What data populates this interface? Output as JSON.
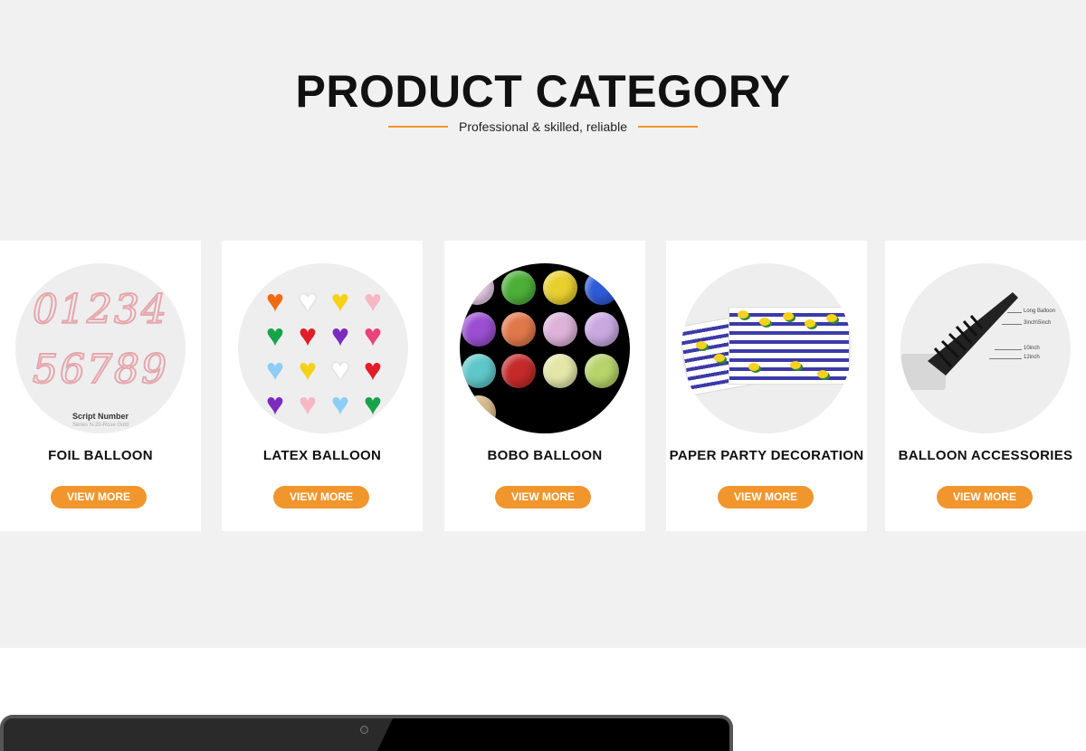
{
  "header": {
    "title": "PRODUCT CATEGORY",
    "subtitle": "Professional & skilled, reliable"
  },
  "categories": [
    {
      "name": "FOIL BALLOON",
      "button": "VIEW MORE",
      "image_caption": "Script Number",
      "image_subcaption": "Series N-20-Rose Gold",
      "digits_row1": "01234",
      "digits_row2": "56789"
    },
    {
      "name": "LATEX BALLOON",
      "button": "VIEW MORE"
    },
    {
      "name": "BOBO BALLOON",
      "button": "VIEW MORE"
    },
    {
      "name": "PAPER PARTY DECORATION",
      "button": "VIEW MORE"
    },
    {
      "name": "BALLOON ACCESSORIES",
      "button": "VIEW MORE",
      "labels": [
        "Long Balloon",
        "3inch\\5inch",
        "10inch",
        "12inch"
      ]
    }
  ],
  "colors": {
    "accent": "#f0962d",
    "background": "#f1f1f1"
  }
}
